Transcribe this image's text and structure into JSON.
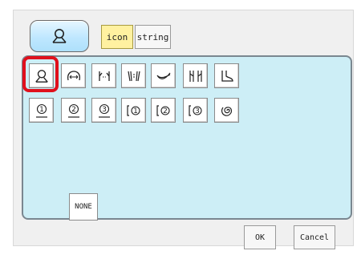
{
  "header": {
    "selected_icon": "person-icon",
    "tabs": [
      {
        "label": "icon",
        "active": true
      },
      {
        "label": "string",
        "active": false
      }
    ]
  },
  "palette": {
    "row1": [
      "person-icon",
      "head-width-icon",
      "neck-width-icon",
      "chest-width-icon",
      "hip-curve-icon",
      "leg-width-icon",
      "boot-icon"
    ],
    "row2": [
      {
        "icon": "circled-one-head-icon",
        "number": "1"
      },
      {
        "icon": "circled-two-head-icon",
        "number": "2"
      },
      {
        "icon": "circled-three-head-icon",
        "number": "3"
      },
      {
        "icon": "bracket-one-icon",
        "number": "1"
      },
      {
        "icon": "bracket-two-icon",
        "number": "2"
      },
      {
        "icon": "bracket-three-icon",
        "number": "3"
      },
      "spiral-icon"
    ],
    "selected_index": 0
  },
  "none_label": "NONE",
  "footer": {
    "ok_label": "OK",
    "cancel_label": "Cancel"
  },
  "colors": {
    "panel": "#cdeef6",
    "highlight_ring": "#e0101c",
    "active_tab": "#fff1a0",
    "header_button": "#bfe7ff"
  }
}
